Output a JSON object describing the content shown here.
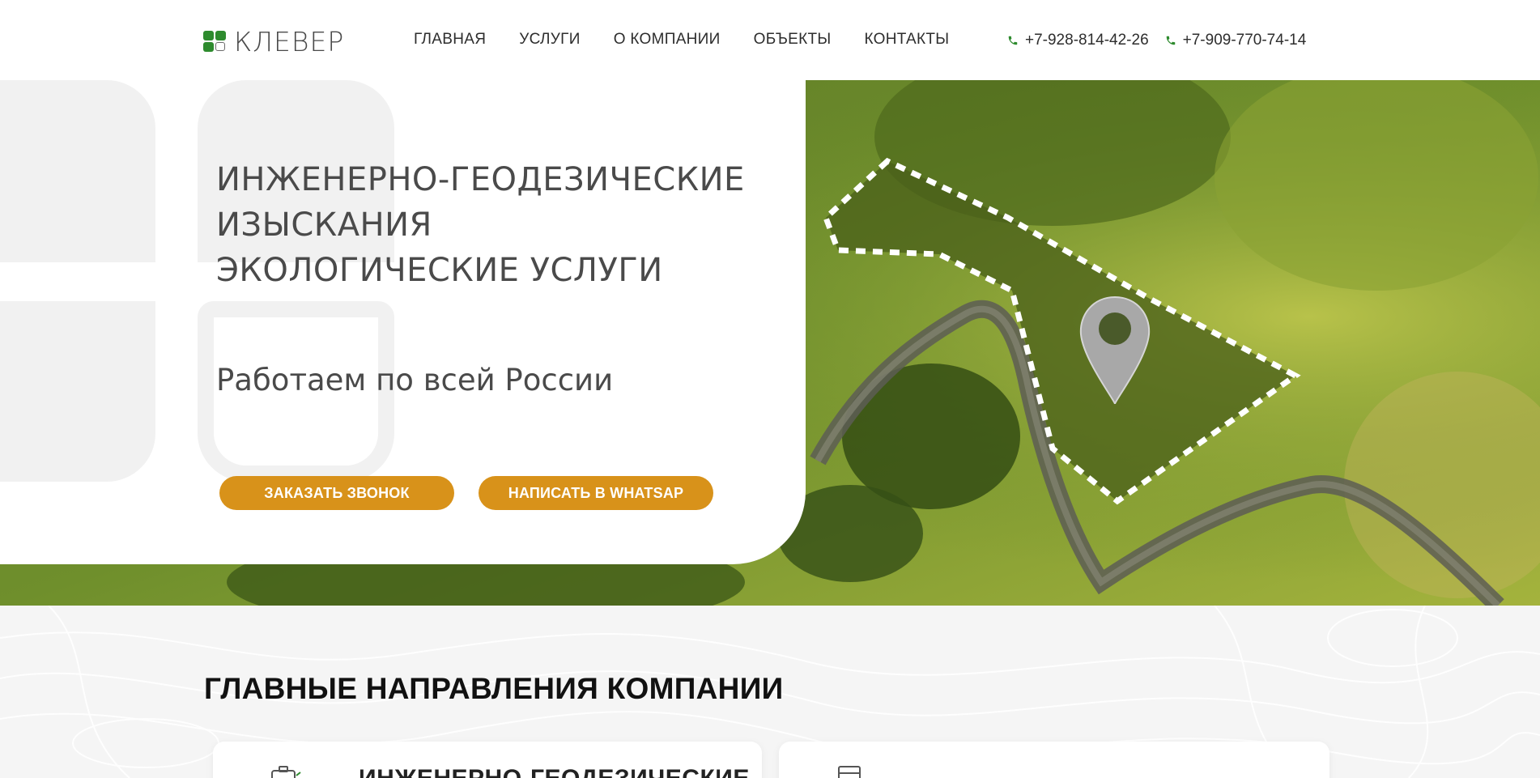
{
  "header": {
    "logo_text": "КЛЕВЕР",
    "nav": [
      "ГЛАВНАЯ",
      "УСЛУГИ",
      "О КОМПАНИИ",
      "ОБЪЕКТЫ",
      "КОНТАКТЫ"
    ],
    "phones": [
      "+7-928-814-42-26",
      "+7-909-770-74-14"
    ]
  },
  "hero": {
    "title_lines": [
      "ИНЖЕНЕРНО-ГЕОДЕЗИЧЕСКИЕ",
      "ИЗЫСКАНИЯ",
      "ЭКОЛОГИЧЕСКИЕ УСЛУГИ"
    ],
    "subtitle": "Работаем по всей России",
    "button_call": "ЗАКАЗАТЬ ЗВОНОК",
    "button_whatsapp": "НАПИСАТЬ В WHATSAP"
  },
  "section": {
    "title": "ГЛАВНЫЕ НАПРАВЛЕНИЯ КОМПАНИИ",
    "cards": [
      {
        "title": "ИНЖЕНЕРНО-ГЕОДЕЗИЧЕСКИЕ",
        "icon": "briefcase-icon"
      },
      {
        "title": "",
        "icon": "document-icon"
      }
    ]
  },
  "colors": {
    "accent": "#d8921a",
    "brand_green": "#2e8b2e",
    "text": "#4a4a4a"
  }
}
